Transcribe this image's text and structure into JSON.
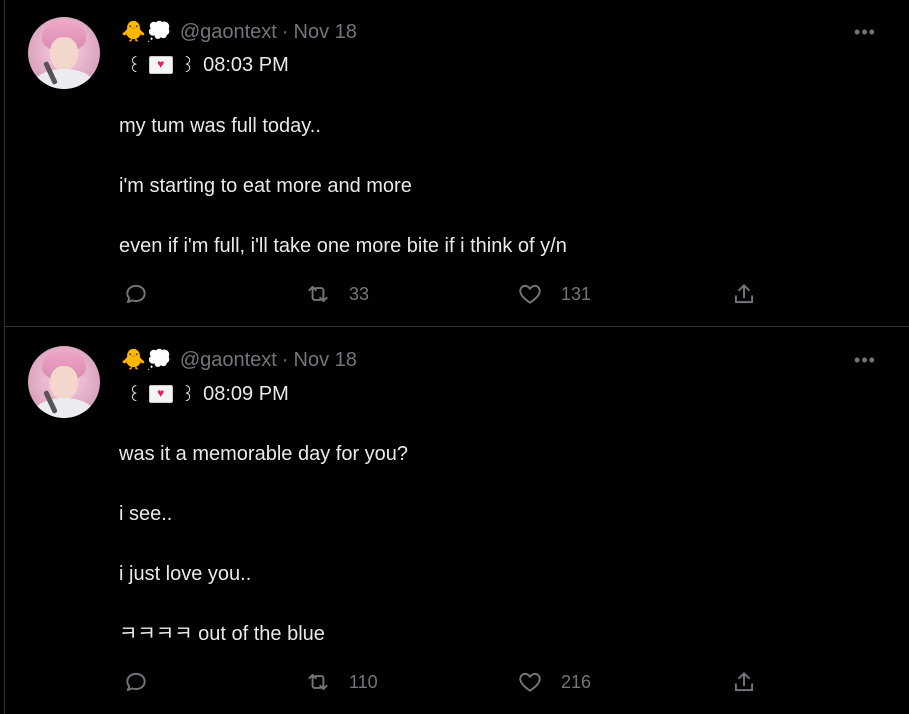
{
  "tweets": [
    {
      "emoji": [
        "🐥",
        "💭"
      ],
      "handle": "@gaontext",
      "separator": "·",
      "date": "Nov 18",
      "name_left": "꒰",
      "name_right": "꒱",
      "time": "08:03 PM",
      "more": "•••",
      "lines": [
        "my tum was full today..",
        "i'm starting to eat more and more",
        "even if i'm full, i'll take one more bite if i think of y/n"
      ],
      "replies": "",
      "retweets": "33",
      "likes": "131"
    },
    {
      "emoji": [
        "🐥",
        "💭"
      ],
      "handle": "@gaontext",
      "separator": "·",
      "date": "Nov 18",
      "name_left": "꒰",
      "name_right": "꒱",
      "time": "08:09 PM",
      "more": "•••",
      "lines": [
        "was it a memorable day for you?",
        "i see..",
        "i just love you..",
        "ㅋㅋㅋㅋ out of the blue"
      ],
      "replies": "",
      "retweets": "110",
      "likes": "216"
    }
  ],
  "colors": {
    "background": "#000000",
    "text_primary": "#e7e9ea",
    "text_secondary": "#71767b",
    "divider": "#2f3336"
  },
  "icons": {
    "reply": "speech-bubble-icon",
    "retweet": "retweet-arrows-icon",
    "like": "heart-icon",
    "share": "share-upload-icon",
    "more": "more-dots-icon",
    "envelope": "love-letter-icon"
  }
}
